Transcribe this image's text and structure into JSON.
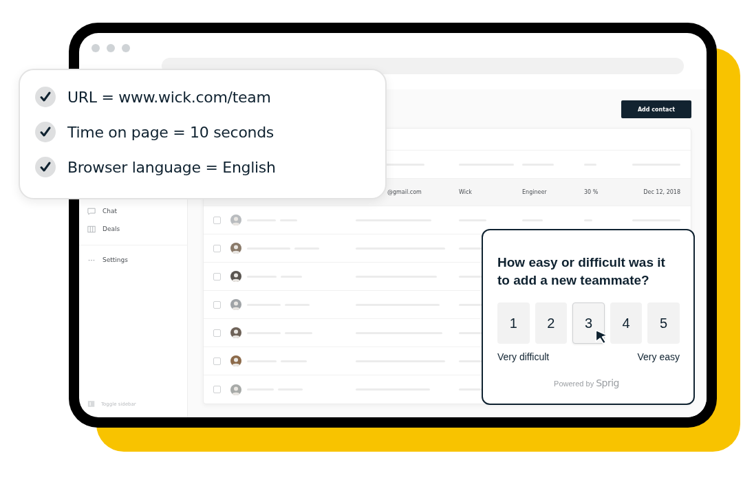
{
  "conditions": [
    {
      "text": "URL = www.wick.com/team",
      "checked": true
    },
    {
      "text": "Time on page = 10 seconds",
      "checked": true
    },
    {
      "text": "Browser language = English",
      "checked": true
    }
  ],
  "sidebar": {
    "items": [
      {
        "label": "Chat",
        "kind": "chat"
      },
      {
        "label": "Deals",
        "kind": "columns"
      },
      {
        "label": "Settings",
        "kind": "more"
      }
    ],
    "toggle": "Toggle sidebar"
  },
  "toolbar": {
    "button": "Add contact"
  },
  "table": {
    "highlighted_row": [
      "@gmail.com",
      "Wick",
      "Engineer",
      "30 %",
      "Dec 12, 2018"
    ],
    "rows": [
      {
        "checked": false
      },
      {
        "checked": false
      },
      {
        "checked": false
      },
      {
        "checked": false
      },
      {
        "checked": false
      },
      {
        "checked": false
      },
      {
        "checked": false
      }
    ]
  },
  "survey": {
    "question": "How easy or difficult was it to add a new teammate?",
    "options": [
      {
        "label": "1",
        "selected": false
      },
      {
        "label": "2",
        "selected": false
      },
      {
        "label": "3",
        "selected": true
      },
      {
        "label": "4",
        "selected": false
      },
      {
        "label": "5",
        "selected": false
      }
    ],
    "low_label": "Very difficult",
    "high_label": "Very easy",
    "powered_by": "Powered by",
    "brand": "Sprig"
  }
}
